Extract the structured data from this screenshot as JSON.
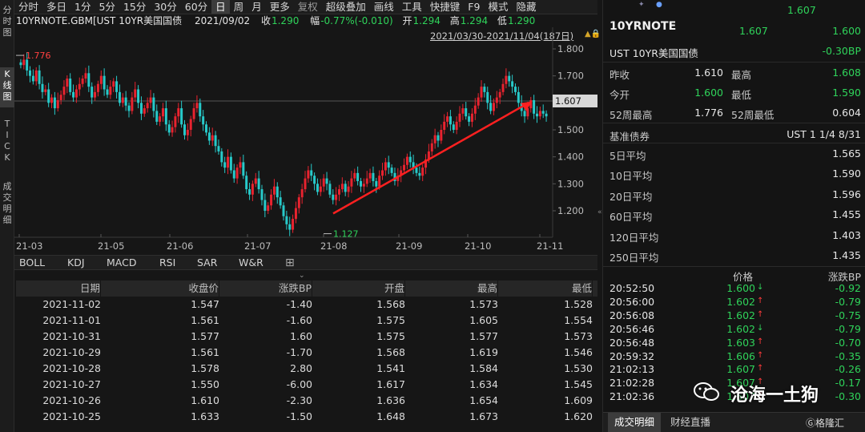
{
  "vtabs": [
    "分\n时\n图",
    "K\n线\n图",
    "T\nI\nC\nK",
    "成\n交\n明\n细"
  ],
  "toolbar": [
    "分时",
    "多日",
    "1分",
    "5分",
    "15分",
    "30分",
    "60分",
    "日",
    "周",
    "月",
    "更多",
    "复权",
    "超级叠加",
    "画线",
    "工具",
    "快捷键",
    "F9",
    "模式",
    "隐藏"
  ],
  "info": {
    "symbol": "10YRNOTE.GBM[UST 10YR美国国债",
    "date": "2021/09/02",
    "close_label": "收",
    "close": "1.290",
    "chg_label": "幅",
    "chg": "-0.77%(-0.010)",
    "open_label": "开",
    "open": "1.294",
    "high_label": "高",
    "high": "1.294",
    "low_label": "低",
    "low": "1.290"
  },
  "range": "2021/03/30-2021/11/04(187日)",
  "chart": {
    "yticks": [
      "1.800",
      "1.700",
      "1.600",
      "1.500",
      "1.400",
      "1.300",
      "1.200"
    ],
    "xticks": [
      "21-03",
      "21-05",
      "21-06",
      "21-07",
      "21-08",
      "21-09",
      "21-10",
      "21-11"
    ],
    "current": "1.607",
    "max": "1.776",
    "min": "1.127",
    "colors": {
      "up": "#e8232f",
      "down": "#27c9c9",
      "arrow": "#ff2020",
      "axis": "#3a3a3a",
      "price_tag": "#d8d8d8"
    }
  },
  "indicators": [
    "BOLL",
    "KDJ",
    "MACD",
    "RSI",
    "SAR",
    "W&R",
    "⊞"
  ],
  "table": {
    "headers": [
      "日期",
      "收盘价",
      "涨跌BP",
      "开盘",
      "最高",
      "最低"
    ],
    "rows": [
      [
        "2021-11-02",
        "1.547",
        "-1.40",
        "1.568",
        "1.573",
        "1.528"
      ],
      [
        "2021-11-01",
        "1.561",
        "-1.60",
        "1.575",
        "1.605",
        "1.554"
      ],
      [
        "2021-10-31",
        "1.577",
        "1.60",
        "1.575",
        "1.577",
        "1.573"
      ],
      [
        "2021-10-29",
        "1.561",
        "-1.70",
        "1.568",
        "1.619",
        "1.546"
      ],
      [
        "2021-10-28",
        "1.578",
        "2.80",
        "1.541",
        "1.584",
        "1.530"
      ],
      [
        "2021-10-27",
        "1.550",
        "-6.00",
        "1.617",
        "1.634",
        "1.545"
      ],
      [
        "2021-10-26",
        "1.610",
        "-2.30",
        "1.636",
        "1.654",
        "1.609"
      ],
      [
        "2021-10-25",
        "1.633",
        "-1.50",
        "1.648",
        "1.673",
        "1.620"
      ]
    ]
  },
  "right": {
    "top_price": "1.607",
    "name": "10YRNOTE",
    "bid": "1.607",
    "ask": "1.600",
    "fullname": "UST 10YR美国国债",
    "change_bp": "-0.30BP",
    "stats": [
      {
        "l1": "昨收",
        "v1": "1.610",
        "l2": "最高",
        "v2": "1.608"
      },
      {
        "l1": "今开",
        "v1": "1.600",
        "l2": "最低",
        "v2": "1.590"
      },
      {
        "l1": "52周最高",
        "v1": "1.776",
        "l2": "52周最低",
        "v2": "0.604"
      }
    ],
    "benchmark_label": "基准债券",
    "benchmark": "UST 1 1/4 8/31",
    "averages": [
      {
        "l": "5日平均",
        "v": "1.565"
      },
      {
        "l": "10日平均",
        "v": "1.590"
      },
      {
        "l": "20日平均",
        "v": "1.596"
      },
      {
        "l": "60日平均",
        "v": "1.455"
      },
      {
        "l": "120日平均",
        "v": "1.403"
      },
      {
        "l": "250日平均",
        "v": "1.435"
      }
    ],
    "trade_headers": [
      "价格",
      "涨跌BP"
    ],
    "trades": [
      {
        "t": "20:52:50",
        "p": "1.600",
        "d": "down",
        "c": "-0.92"
      },
      {
        "t": "20:56:00",
        "p": "1.602",
        "d": "up",
        "c": "-0.79"
      },
      {
        "t": "20:56:08",
        "p": "1.602",
        "d": "up",
        "c": "-0.75"
      },
      {
        "t": "20:56:46",
        "p": "1.602",
        "d": "down",
        "c": "-0.79"
      },
      {
        "t": "20:56:48",
        "p": "1.603",
        "d": "up",
        "c": "-0.70"
      },
      {
        "t": "20:59:32",
        "p": "1.606",
        "d": "up",
        "c": "-0.35"
      },
      {
        "t": "21:02:13",
        "p": "1.607",
        "d": "up",
        "c": "-0.26"
      },
      {
        "t": "21:02:28",
        "p": "1.607",
        "d": "up",
        "c": "-0.17"
      },
      {
        "t": "21:02:36",
        "p": "1.607",
        "d": "up",
        "c": "-0.30"
      }
    ],
    "bottom_tabs": [
      "成交明细",
      "财经直播"
    ],
    "watermark": "沧海一土狗",
    "brand": "格隆汇"
  }
}
